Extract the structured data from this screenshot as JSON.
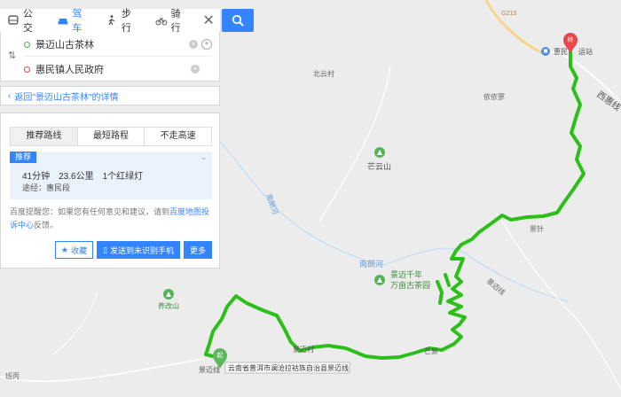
{
  "tabs": [
    {
      "label": "公交",
      "icon": "bus-icon"
    },
    {
      "label": "驾车",
      "icon": "car-icon"
    },
    {
      "label": "步行",
      "icon": "walk-icon"
    },
    {
      "label": "骑行",
      "icon": "bike-icon"
    }
  ],
  "route": {
    "origin": "景迈山古茶林",
    "destination": "惠民镇人民政府",
    "back_link": "返回\"景迈山古茶林\"的详情"
  },
  "options": [
    "推荐路线",
    "最短路程",
    "不走高速"
  ],
  "result": {
    "badge": "推荐",
    "duration": "41分钟",
    "distance": "23.6公里",
    "lights": "1个红绿灯",
    "via": "途经：惠民段"
  },
  "note": {
    "prefix": "百度提醒您：如果您有任何意见和建议，请到",
    "link": "百度地图投诉中心",
    "suffix": "反馈。"
  },
  "actions": {
    "favorite": "收藏",
    "send": "发送到未识别手机",
    "more": "更多"
  },
  "map": {
    "labels": {
      "highway": "G213",
      "end_station": "惠民",
      "end_station_tail": "运站",
      "xihui": "西惠线",
      "beiyun": "北云村",
      "yiyiliao": "依依寥",
      "mangyunshan": "芒云山",
      "nanlanghe1": "南朗河",
      "nanlanghe2": "南朗河",
      "jingmai_road": "景迈线",
      "mangba": "景针",
      "tea_garden": "景迈千年万亩古茶园",
      "tea_garden_l1": "景迈千年",
      "tea_garden_l2": "万亩古茶园",
      "yangai": "养改山",
      "jingmaicun": "景迈村",
      "mangjing": "芒景",
      "banbing": "班丙",
      "start_badge": "起",
      "end_badge": "终",
      "start_tooltip": "云南省普洱市澜沧拉祜族自治县景迈线",
      "start_place": "景迈线"
    },
    "route_color": "#2bc017"
  }
}
